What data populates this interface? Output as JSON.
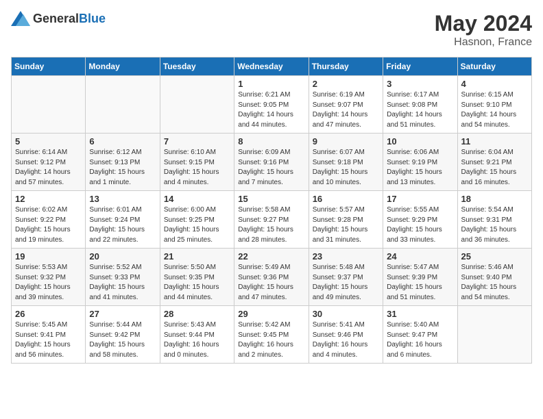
{
  "header": {
    "logo_general": "General",
    "logo_blue": "Blue",
    "title": "May 2024",
    "location": "Hasnon, France"
  },
  "weekdays": [
    "Sunday",
    "Monday",
    "Tuesday",
    "Wednesday",
    "Thursday",
    "Friday",
    "Saturday"
  ],
  "weeks": [
    [
      {
        "day": "",
        "empty": true
      },
      {
        "day": "",
        "empty": true
      },
      {
        "day": "",
        "empty": true
      },
      {
        "day": "1",
        "sunrise": "Sunrise: 6:21 AM",
        "sunset": "Sunset: 9:05 PM",
        "daylight": "Daylight: 14 hours and 44 minutes."
      },
      {
        "day": "2",
        "sunrise": "Sunrise: 6:19 AM",
        "sunset": "Sunset: 9:07 PM",
        "daylight": "Daylight: 14 hours and 47 minutes."
      },
      {
        "day": "3",
        "sunrise": "Sunrise: 6:17 AM",
        "sunset": "Sunset: 9:08 PM",
        "daylight": "Daylight: 14 hours and 51 minutes."
      },
      {
        "day": "4",
        "sunrise": "Sunrise: 6:15 AM",
        "sunset": "Sunset: 9:10 PM",
        "daylight": "Daylight: 14 hours and 54 minutes."
      }
    ],
    [
      {
        "day": "5",
        "sunrise": "Sunrise: 6:14 AM",
        "sunset": "Sunset: 9:12 PM",
        "daylight": "Daylight: 14 hours and 57 minutes."
      },
      {
        "day": "6",
        "sunrise": "Sunrise: 6:12 AM",
        "sunset": "Sunset: 9:13 PM",
        "daylight": "Daylight: 15 hours and 1 minute."
      },
      {
        "day": "7",
        "sunrise": "Sunrise: 6:10 AM",
        "sunset": "Sunset: 9:15 PM",
        "daylight": "Daylight: 15 hours and 4 minutes."
      },
      {
        "day": "8",
        "sunrise": "Sunrise: 6:09 AM",
        "sunset": "Sunset: 9:16 PM",
        "daylight": "Daylight: 15 hours and 7 minutes."
      },
      {
        "day": "9",
        "sunrise": "Sunrise: 6:07 AM",
        "sunset": "Sunset: 9:18 PM",
        "daylight": "Daylight: 15 hours and 10 minutes."
      },
      {
        "day": "10",
        "sunrise": "Sunrise: 6:06 AM",
        "sunset": "Sunset: 9:19 PM",
        "daylight": "Daylight: 15 hours and 13 minutes."
      },
      {
        "day": "11",
        "sunrise": "Sunrise: 6:04 AM",
        "sunset": "Sunset: 9:21 PM",
        "daylight": "Daylight: 15 hours and 16 minutes."
      }
    ],
    [
      {
        "day": "12",
        "sunrise": "Sunrise: 6:02 AM",
        "sunset": "Sunset: 9:22 PM",
        "daylight": "Daylight: 15 hours and 19 minutes."
      },
      {
        "day": "13",
        "sunrise": "Sunrise: 6:01 AM",
        "sunset": "Sunset: 9:24 PM",
        "daylight": "Daylight: 15 hours and 22 minutes."
      },
      {
        "day": "14",
        "sunrise": "Sunrise: 6:00 AM",
        "sunset": "Sunset: 9:25 PM",
        "daylight": "Daylight: 15 hours and 25 minutes."
      },
      {
        "day": "15",
        "sunrise": "Sunrise: 5:58 AM",
        "sunset": "Sunset: 9:27 PM",
        "daylight": "Daylight: 15 hours and 28 minutes."
      },
      {
        "day": "16",
        "sunrise": "Sunrise: 5:57 AM",
        "sunset": "Sunset: 9:28 PM",
        "daylight": "Daylight: 15 hours and 31 minutes."
      },
      {
        "day": "17",
        "sunrise": "Sunrise: 5:55 AM",
        "sunset": "Sunset: 9:29 PM",
        "daylight": "Daylight: 15 hours and 33 minutes."
      },
      {
        "day": "18",
        "sunrise": "Sunrise: 5:54 AM",
        "sunset": "Sunset: 9:31 PM",
        "daylight": "Daylight: 15 hours and 36 minutes."
      }
    ],
    [
      {
        "day": "19",
        "sunrise": "Sunrise: 5:53 AM",
        "sunset": "Sunset: 9:32 PM",
        "daylight": "Daylight: 15 hours and 39 minutes."
      },
      {
        "day": "20",
        "sunrise": "Sunrise: 5:52 AM",
        "sunset": "Sunset: 9:33 PM",
        "daylight": "Daylight: 15 hours and 41 minutes."
      },
      {
        "day": "21",
        "sunrise": "Sunrise: 5:50 AM",
        "sunset": "Sunset: 9:35 PM",
        "daylight": "Daylight: 15 hours and 44 minutes."
      },
      {
        "day": "22",
        "sunrise": "Sunrise: 5:49 AM",
        "sunset": "Sunset: 9:36 PM",
        "daylight": "Daylight: 15 hours and 47 minutes."
      },
      {
        "day": "23",
        "sunrise": "Sunrise: 5:48 AM",
        "sunset": "Sunset: 9:37 PM",
        "daylight": "Daylight: 15 hours and 49 minutes."
      },
      {
        "day": "24",
        "sunrise": "Sunrise: 5:47 AM",
        "sunset": "Sunset: 9:39 PM",
        "daylight": "Daylight: 15 hours and 51 minutes."
      },
      {
        "day": "25",
        "sunrise": "Sunrise: 5:46 AM",
        "sunset": "Sunset: 9:40 PM",
        "daylight": "Daylight: 15 hours and 54 minutes."
      }
    ],
    [
      {
        "day": "26",
        "sunrise": "Sunrise: 5:45 AM",
        "sunset": "Sunset: 9:41 PM",
        "daylight": "Daylight: 15 hours and 56 minutes."
      },
      {
        "day": "27",
        "sunrise": "Sunrise: 5:44 AM",
        "sunset": "Sunset: 9:42 PM",
        "daylight": "Daylight: 15 hours and 58 minutes."
      },
      {
        "day": "28",
        "sunrise": "Sunrise: 5:43 AM",
        "sunset": "Sunset: 9:44 PM",
        "daylight": "Daylight: 16 hours and 0 minutes."
      },
      {
        "day": "29",
        "sunrise": "Sunrise: 5:42 AM",
        "sunset": "Sunset: 9:45 PM",
        "daylight": "Daylight: 16 hours and 2 minutes."
      },
      {
        "day": "30",
        "sunrise": "Sunrise: 5:41 AM",
        "sunset": "Sunset: 9:46 PM",
        "daylight": "Daylight: 16 hours and 4 minutes."
      },
      {
        "day": "31",
        "sunrise": "Sunrise: 5:40 AM",
        "sunset": "Sunset: 9:47 PM",
        "daylight": "Daylight: 16 hours and 6 minutes."
      },
      {
        "day": "",
        "empty": true
      }
    ]
  ]
}
